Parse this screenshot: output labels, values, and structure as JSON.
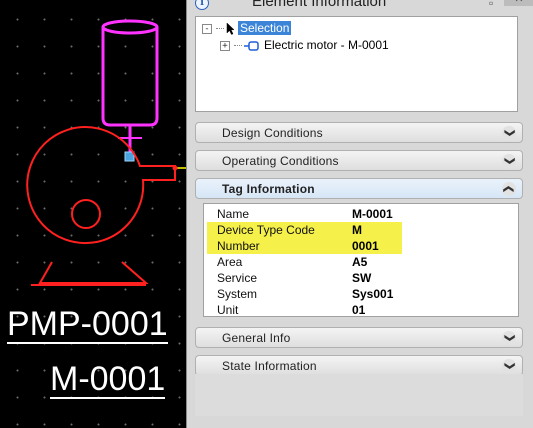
{
  "canvas": {
    "labels": {
      "pump_tag": "PMP-0001",
      "motor_tag": "M-0001"
    },
    "colors": {
      "background": "#000000",
      "pump": "#ff2020",
      "motor": "#ff33ff",
      "connector": "#4aa3df",
      "line": "#ffff00"
    }
  },
  "panel": {
    "title": "Element Information",
    "info_icon": "info-icon",
    "close_label": "✕",
    "tree": {
      "root_label": "Selection",
      "root_expander": "-",
      "child_label": "Electric motor - M-0001",
      "child_expander": "+"
    },
    "sections": [
      {
        "label": "Design Conditions",
        "chevron": "❯",
        "expanded": false
      },
      {
        "label": "Operating Conditions",
        "chevron": "❯",
        "expanded": false
      },
      {
        "label": "Tag Information",
        "chevron": "❯",
        "expanded": true
      },
      {
        "label": "General Info",
        "chevron": "❯",
        "expanded": false
      },
      {
        "label": "State Information",
        "chevron": "❯",
        "expanded": false
      }
    ],
    "tag_properties": [
      {
        "name": "Name",
        "value": "M-0001",
        "highlighted": false
      },
      {
        "name": "Device Type Code",
        "value": "M",
        "highlighted": true
      },
      {
        "name": "Number",
        "value": "0001",
        "highlighted": true
      },
      {
        "name": "Area",
        "value": "A5",
        "highlighted": false
      },
      {
        "name": "Service",
        "value": "SW",
        "highlighted": false
      },
      {
        "name": "System",
        "value": "Sys001",
        "highlighted": false
      },
      {
        "name": "Unit",
        "value": "01",
        "highlighted": false
      }
    ],
    "highlight_color": "#f5f04a"
  }
}
